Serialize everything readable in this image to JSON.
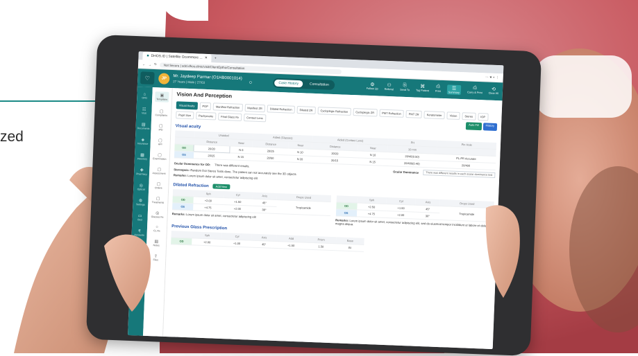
{
  "caption": {
    "text": "zed"
  },
  "browser": {
    "tab_title": "DHOS.ID | Satellite Ocommerc ...",
    "url": "Not Secure | sdcl.dhos.clinic/visit/ClientOptho/Consultation"
  },
  "header": {
    "patient_name": "Mr. Jaydeep Parmar (O1HB0001014)",
    "patient_meta": "27 Years | Male | 27/03",
    "tab_case_history": "Case History",
    "tab_consultation": "Consultation",
    "icons": [
      {
        "label": "Follow Up",
        "icon": "gear-icon"
      },
      {
        "label": "Referral",
        "icon": "users-icon"
      },
      {
        "label": "Send To",
        "icon": "send-icon"
      },
      {
        "label": "Tag Patient",
        "icon": "tag-icon"
      },
      {
        "label": "Print",
        "icon": "print-icon"
      },
      {
        "label": "Summary",
        "icon": "summary-icon",
        "selected": true
      },
      {
        "label": "Carry & Print",
        "icon": "print-icon"
      },
      {
        "label": "Clear All",
        "icon": "clear-icon"
      }
    ]
  },
  "leftnav": [
    {
      "label": "OPD",
      "icon": "opd-icon"
    },
    {
      "label": "Visit",
      "icon": "visit-icon"
    },
    {
      "label": "Documents",
      "icon": "doc-icon"
    },
    {
      "label": "Insurance",
      "icon": "insurance-icon"
    },
    {
      "label": "Inventory",
      "icon": "inventory-icon"
    },
    {
      "label": "Pharmacy",
      "icon": "pharmacy-icon"
    },
    {
      "label": "Optical",
      "icon": "glasses-icon"
    },
    {
      "label": "Settings",
      "icon": "gear-icon"
    },
    {
      "label": "Bed",
      "icon": "bed-icon"
    },
    {
      "label": "Accounts",
      "icon": "accounts-icon"
    },
    {
      "label": "Audit",
      "icon": "audit-icon"
    }
  ],
  "subnav": [
    {
      "label": "Templates",
      "icon": "template-icon",
      "selected": true
    },
    {
      "label": "Complaints",
      "icon": "complaint-icon"
    },
    {
      "label": "IPD",
      "icon": "ipd-icon"
    },
    {
      "label": "HPI",
      "icon": "hpi-icon"
    },
    {
      "label": "Examination",
      "icon": "exam-icon"
    },
    {
      "label": "Assessment",
      "icon": "assess-icon"
    },
    {
      "label": "Orders",
      "icon": "orders-icon"
    },
    {
      "label": "Treatments",
      "icon": "treatment-icon"
    },
    {
      "label": "Glasses Rx",
      "icon": "glasses-icon"
    },
    {
      "label": "CL Rx",
      "icon": "lens-icon"
    },
    {
      "label": "Notes",
      "icon": "notes-icon"
    },
    {
      "label": "Files",
      "icon": "files-icon"
    }
  ],
  "main": {
    "title": "Vision And Perception",
    "tabs": [
      "Visual Acuity",
      "PGP",
      "Manifest Refraction",
      "Manifest ZR",
      "Dilated Refraction",
      "Dilated ZR",
      "Cycloplegic Refraction",
      "Cycloplegic ZR",
      "PMT Refraction",
      "PMT ZR",
      "Keratometer",
      "Vision",
      "Stereo",
      "IOP",
      "Pupil Size",
      "Pachymetry",
      "Final Glass Rx",
      "Contact Lens"
    ],
    "btn_auto_fill": "Auto Fill",
    "btn_history": "History",
    "visual_acuity": {
      "title": "Visual acuity",
      "group_headers": [
        "Unaided",
        "Aided (Glasses)",
        "Aided (Contact Lens)",
        "PH",
        "Pin Hole"
      ],
      "sub_headers": [
        "Distance",
        "Near",
        "Distance",
        "Near",
        "Distance",
        "Near",
        "10 mm",
        ""
      ],
      "rows": [
        {
          "eye": "OD",
          "cells": [
            "20/20",
            "N 6",
            "20/25",
            "N 10",
            "20/20",
            "N 10",
            "20/40(0.50)",
            "PL-PR Accurate"
          ]
        },
        {
          "eye": "OS",
          "cells": [
            "20/25",
            "N 15",
            "20/50",
            "N 20",
            "20/15",
            "N 15",
            "20/400(0.40)",
            "20/400"
          ]
        }
      ],
      "ocular_dominance_label": "Ocular Dominance for OD:",
      "ocular_dominance_text": "There was different results.",
      "ocular_dominance_right_label": "Ocular Dominance",
      "ocular_dominance_note": "There was different results in each ocular dominance test",
      "stereopsis": "Random Dot Stereo Tests done. The patient can not accurately see the 3D objects",
      "remarks": "Lorem ipsum dolor sit amet, consectetur adipiscing elit"
    },
    "dilated_refraction": {
      "title": "Dilated Refraction",
      "btn_add_new": "Add New",
      "headers": [
        "Sph",
        "Cyl",
        "Axis",
        "Drops Used"
      ],
      "od": {
        "sph": "+2.00",
        "cyl": "+1.50",
        "axis": "45°"
      },
      "os": {
        "sph": "+4.75",
        "cyl": "+2.00",
        "axis": "38°"
      },
      "drops_left": "Tropicamide",
      "od2": {
        "sph": "+2.50",
        "cyl": "+1.00",
        "axis": "45°"
      },
      "os2": {
        "sph": "+4.75",
        "cyl": "+2.00",
        "axis": "30°"
      },
      "drops_right": "Tropicamide",
      "remarks_left": "Lorem ipsum dolor sit amet, consectetur adipiscing elit",
      "remarks_right": "Lorem ipsum dolor sit amet, consectetur adipiscing elit, sed do eiusmod tempor incididunt ut labore et dolore magna aliqua."
    },
    "previous_glass": {
      "title": "Previous Glass Prescription",
      "headers": [
        "Sph",
        "Cyl",
        "Axis",
        "Add",
        "Prism",
        "Base"
      ],
      "rows": [
        {
          "eye": "OD",
          "cells": [
            "+2.00",
            "+1.00",
            "45°",
            "+1.50",
            "1.50",
            "BI"
          ]
        }
      ]
    }
  },
  "colors": {
    "accent": "#16787a",
    "link": "#1f4fa8",
    "brand_red": "#c43a32"
  }
}
